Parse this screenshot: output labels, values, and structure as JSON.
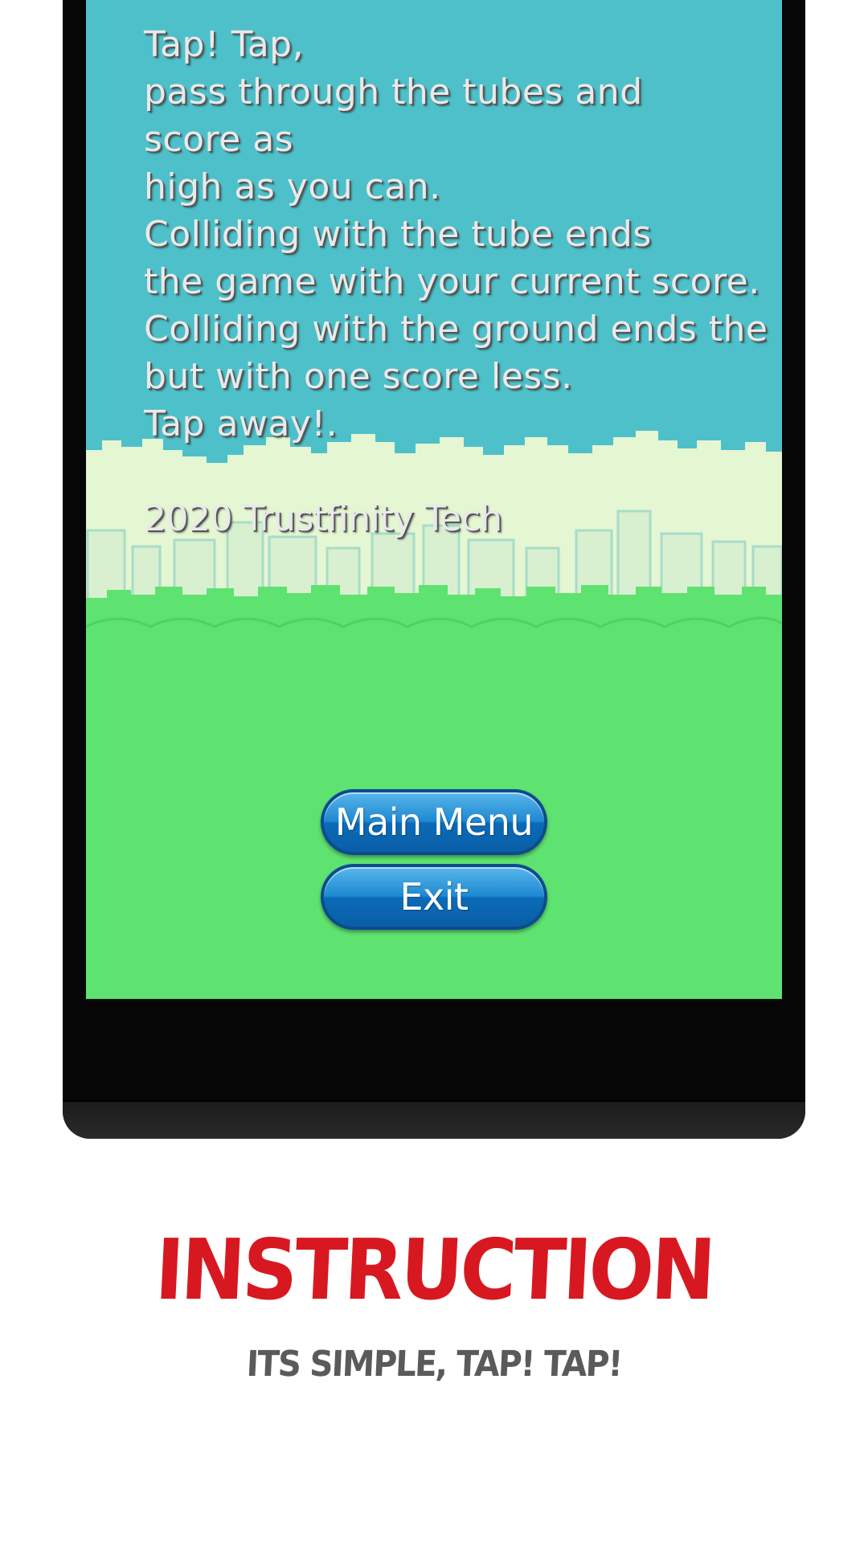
{
  "game": {
    "instructions": [
      "Tap! Tap,",
      "pass through the tubes and",
      "score as",
      "high as you can.",
      "Colliding with the tube ends",
      "the game with your current score.",
      "Colliding with the ground ends the",
      "but with one score less.",
      "Tap away!."
    ],
    "copyright": "2020 Trustfinity Tech",
    "buttons": {
      "main_menu": "Main Menu",
      "exit": "Exit"
    },
    "colors": {
      "sky": "#4ec0ca",
      "grass": "#5ee270",
      "button": "#1f8ad2"
    }
  },
  "navbar": {
    "icons": [
      "recent-apps-icon",
      "home-icon",
      "back-icon"
    ]
  },
  "promo": {
    "headline": "INSTRUCTION",
    "subline": "ITS SIMPLE, TAP! TAP!",
    "headline_color": "#d81820"
  }
}
